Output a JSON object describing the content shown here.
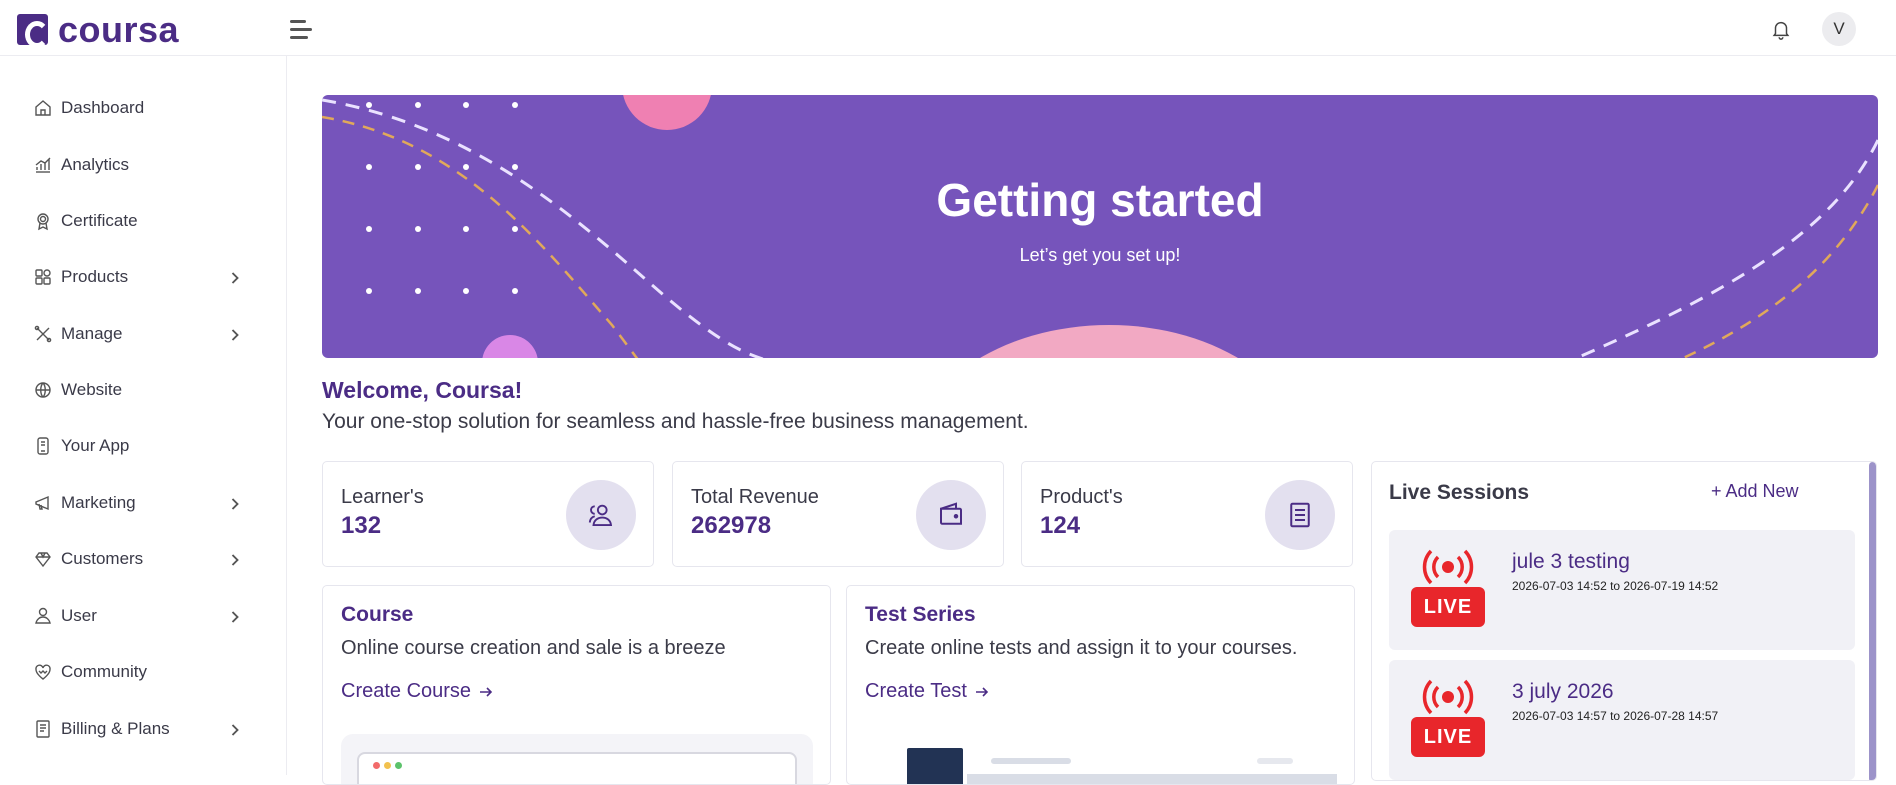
{
  "brand": {
    "name": "coursa",
    "color": "#4b2c85"
  },
  "header": {
    "avatar_initial": "V"
  },
  "sidebar": {
    "items": [
      {
        "label": "Dashboard",
        "icon": "home-icon",
        "has_submenu": false
      },
      {
        "label": "Analytics",
        "icon": "analytics-icon",
        "has_submenu": false
      },
      {
        "label": "Certificate",
        "icon": "certificate-icon",
        "has_submenu": false
      },
      {
        "label": "Products",
        "icon": "products-icon",
        "has_submenu": true
      },
      {
        "label": "Manage",
        "icon": "tools-icon",
        "has_submenu": true
      },
      {
        "label": "Website",
        "icon": "globe-icon",
        "has_submenu": false
      },
      {
        "label": "Your App",
        "icon": "mobile-icon",
        "has_submenu": false
      },
      {
        "label": "Marketing",
        "icon": "marketing-icon",
        "has_submenu": true
      },
      {
        "label": "Customers",
        "icon": "customers-icon",
        "has_submenu": true
      },
      {
        "label": "User",
        "icon": "user-icon",
        "has_submenu": true
      },
      {
        "label": "Community",
        "icon": "community-icon",
        "has_submenu": false
      },
      {
        "label": "Billing & Plans",
        "icon": "billing-icon",
        "has_submenu": true
      }
    ]
  },
  "hero": {
    "title": "Getting started",
    "subtitle": "Let’s get you set up!",
    "background": "#7654bb"
  },
  "welcome": {
    "title": "Welcome, Coursa!",
    "subtitle": "Your one-stop solution for seamless and hassle-free business management."
  },
  "stats": [
    {
      "label": "Learner's",
      "value": "132",
      "icon": "users-icon"
    },
    {
      "label": "Total Revenue",
      "value": "262978",
      "icon": "wallet-icon"
    },
    {
      "label": "Product's",
      "value": "124",
      "icon": "book-icon"
    }
  ],
  "cards": [
    {
      "title": "Course",
      "description": "Online course creation and sale is a breeze",
      "link": "Create Course"
    },
    {
      "title": "Test Series",
      "description": "Create online tests and assign it to your courses.",
      "link": "Create Test"
    }
  ],
  "live_sessions": {
    "title": "Live Sessions",
    "add_label": "+ Add New",
    "badge_text": "LIVE",
    "items": [
      {
        "name": "jule 3 testing",
        "time": "2026-07-03 14:52 to 2026-07-19 14:52"
      },
      {
        "name": "3 july 2026",
        "time": "2026-07-03 14:57 to 2026-07-28 14:57"
      }
    ]
  }
}
